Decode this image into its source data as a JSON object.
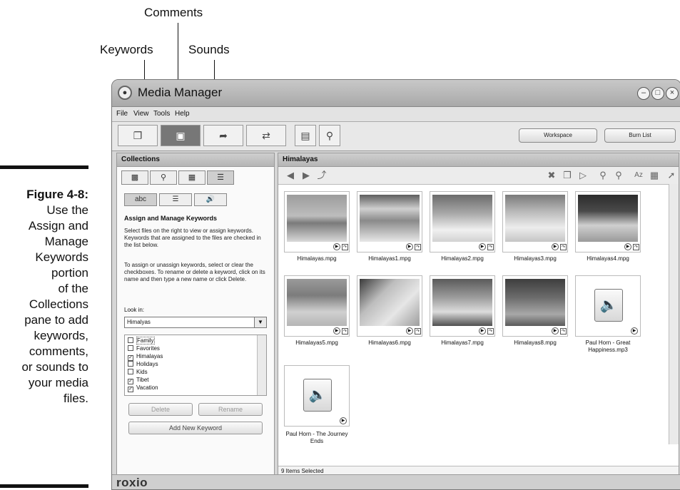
{
  "callouts": {
    "comments": "Comments",
    "keywords": "Keywords",
    "sounds": "Sounds"
  },
  "caption": {
    "label": "Figure 4-8:",
    "lines": [
      "Use the",
      "Assign and",
      "Manage",
      "Keywords",
      "portion",
      "of the",
      "Collections",
      "pane to add",
      "keywords,",
      "comments,",
      "or sounds to",
      "your media",
      "files."
    ]
  },
  "window": {
    "title": "Media Manager"
  },
  "menu": {
    "items": [
      "File",
      "View",
      "Tools",
      "Help"
    ]
  },
  "toolbar": {
    "workspace": "Workspace",
    "burn_list": "Burn List"
  },
  "collections": {
    "title": "Collections",
    "section_title": "Assign and Manage Keywords",
    "para1": "Select files on the right to view or assign keywords. Keywords that are assigned to the files are checked in the list below.",
    "para2": "To assign or unassign keywords, select or clear the checkboxes. To rename or delete a keyword, click on its name and then type a new name or click Delete.",
    "look_in_label": "Look in:",
    "look_in_value": "Himalyas",
    "keywords": [
      {
        "label": "Family",
        "checked": false
      },
      {
        "label": "Favorites",
        "checked": false
      },
      {
        "label": "Himalayas",
        "checked": true
      },
      {
        "label": "Holidays",
        "checked": false
      },
      {
        "label": "Kids",
        "checked": false
      },
      {
        "label": "Tibet",
        "checked": true
      },
      {
        "label": "Vacation",
        "checked": true
      }
    ],
    "delete": "Delete",
    "rename": "Rename",
    "add_new": "Add New Keyword"
  },
  "media": {
    "title": "Himalayas",
    "files": [
      "Himalayas.mpg",
      "Himalayas1.mpg",
      "Himalayas2.mpg",
      "Himalayas3.mpg",
      "Himalayas4.mpg",
      "Himalayas5.mpg",
      "Himalayas6.mpg",
      "Himalayas7.mpg",
      "Himalayas8.mpg",
      "Paul Horn - Great Happiness.mp3",
      "Paul Horn - The Journey Ends"
    ],
    "status": "9 Items Selected"
  },
  "brand": "roxio"
}
